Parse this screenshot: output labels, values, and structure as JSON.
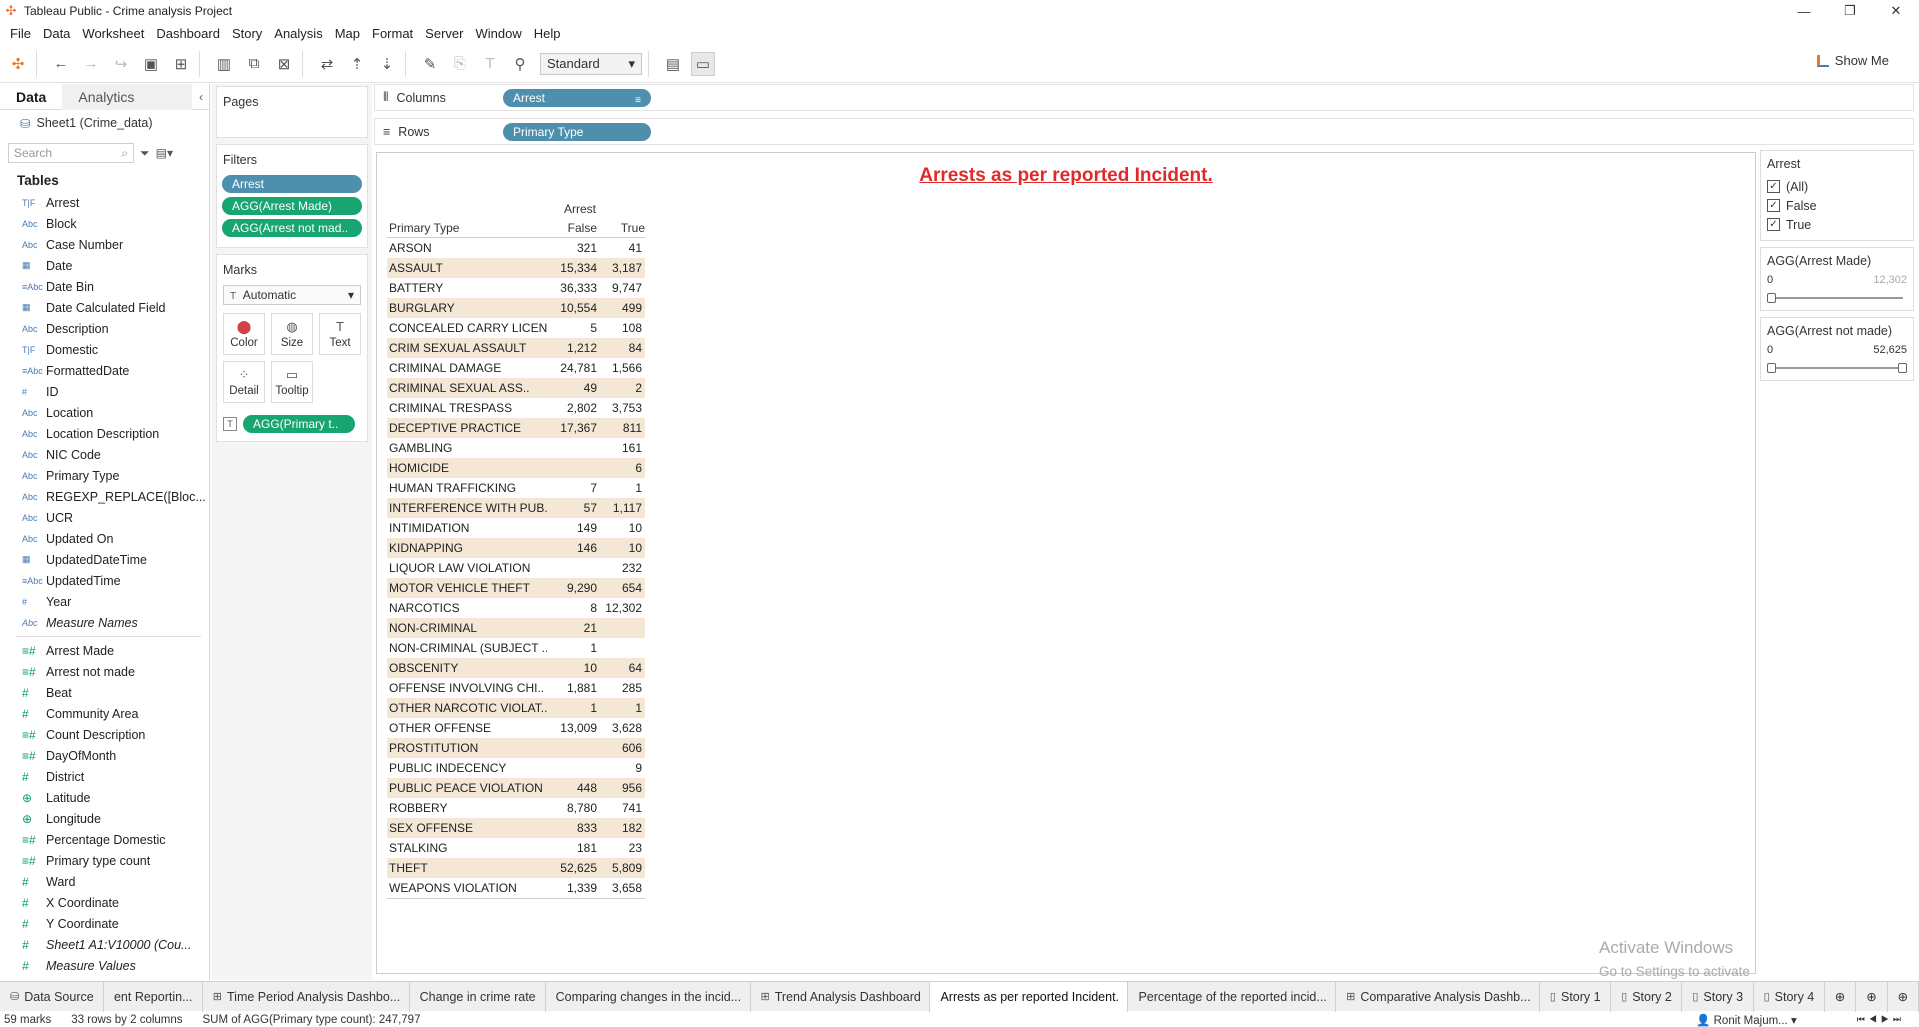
{
  "window": {
    "title": "Tableau Public - Crime analysis Project"
  },
  "menu": [
    "File",
    "Data",
    "Worksheet",
    "Dashboard",
    "Story",
    "Analysis",
    "Map",
    "Format",
    "Server",
    "Window",
    "Help"
  ],
  "toolbar": {
    "fit": "Standard",
    "show_me": "Show Me"
  },
  "datapane": {
    "tab_data": "Data",
    "tab_analytics": "Analytics",
    "datasource": "Sheet1 (Crime_data)",
    "search_placeholder": "Search",
    "tables_heading": "Tables",
    "dimensions": [
      {
        "type": "T|F",
        "name": "Arrest"
      },
      {
        "type": "Abc",
        "name": "Block"
      },
      {
        "type": "Abc",
        "name": "Case Number"
      },
      {
        "type": "▦",
        "name": "Date"
      },
      {
        "type": "≡Abc",
        "name": "Date Bin"
      },
      {
        "type": "▦",
        "name": "Date Calculated Field"
      },
      {
        "type": "Abc",
        "name": "Description"
      },
      {
        "type": "T|F",
        "name": "Domestic"
      },
      {
        "type": "≡Abc",
        "name": "FormattedDate"
      },
      {
        "type": "#",
        "name": "ID"
      },
      {
        "type": "Abc",
        "name": "Location"
      },
      {
        "type": "Abc",
        "name": "Location Description"
      },
      {
        "type": "Abc",
        "name": "NIC Code"
      },
      {
        "type": "Abc",
        "name": "Primary Type"
      },
      {
        "type": "Abc",
        "name": "REGEXP_REPLACE([Bloc..."
      },
      {
        "type": "Abc",
        "name": "UCR"
      },
      {
        "type": "Abc",
        "name": "Updated On"
      },
      {
        "type": "▦",
        "name": "UpdatedDateTime"
      },
      {
        "type": "≡Abc",
        "name": "UpdatedTime"
      },
      {
        "type": "#",
        "name": "Year"
      },
      {
        "type": "Abc",
        "name": "Measure Names",
        "italic": true
      }
    ],
    "measures": [
      {
        "type": "≡#",
        "name": "Arrest Made"
      },
      {
        "type": "≡#",
        "name": "Arrest not made"
      },
      {
        "type": "#",
        "name": "Beat"
      },
      {
        "type": "#",
        "name": "Community Area"
      },
      {
        "type": "≡#",
        "name": "Count Description"
      },
      {
        "type": "≡#",
        "name": "DayOfMonth"
      },
      {
        "type": "#",
        "name": "District"
      },
      {
        "type": "⊕",
        "name": "Latitude"
      },
      {
        "type": "⊕",
        "name": "Longitude"
      },
      {
        "type": "≡#",
        "name": "Percentage Domestic"
      },
      {
        "type": "≡#",
        "name": "Primary type count"
      },
      {
        "type": "#",
        "name": "Ward"
      },
      {
        "type": "#",
        "name": "X Coordinate"
      },
      {
        "type": "#",
        "name": "Y Coordinate"
      },
      {
        "type": "#",
        "name": "Sheet1 A1:V10000 (Cou...",
        "italic": true
      },
      {
        "type": "#",
        "name": "Measure Values",
        "italic": true
      }
    ]
  },
  "shelves": {
    "pages_label": "Pages",
    "filters_label": "Filters",
    "filters": [
      {
        "label": "Arrest",
        "color": "blue"
      },
      {
        "label": "AGG(Arrest Made)",
        "color": "green"
      },
      {
        "label": "AGG(Arrest not mad..",
        "color": "green"
      }
    ],
    "marks_label": "Marks",
    "mark_type": "Automatic",
    "mark_buttons": [
      {
        "label": "Color",
        "icon": "color-icon"
      },
      {
        "label": "Size",
        "icon": "size-icon"
      },
      {
        "label": "Text",
        "icon": "text-icon"
      },
      {
        "label": "Detail",
        "icon": "detail-icon"
      },
      {
        "label": "Tooltip",
        "icon": "tooltip-icon"
      }
    ],
    "mark_pill": "AGG(Primary t..",
    "columns_label": "Columns",
    "columns_pill": "Arrest",
    "rows_label": "Rows",
    "rows_pill": "Primary Type"
  },
  "view": {
    "title": "Arrests as per reported Incident.",
    "col_header": "Arrest",
    "row_header": "Primary Type",
    "col_values": [
      "False",
      "True"
    ],
    "rows": [
      [
        "ARSON",
        "321",
        "41"
      ],
      [
        "ASSAULT",
        "15,334",
        "3,187"
      ],
      [
        "BATTERY",
        "36,333",
        "9,747"
      ],
      [
        "BURGLARY",
        "10,554",
        "499"
      ],
      [
        "CONCEALED CARRY LICEN..",
        "5",
        "108"
      ],
      [
        "CRIM SEXUAL ASSAULT",
        "1,212",
        "84"
      ],
      [
        "CRIMINAL DAMAGE",
        "24,781",
        "1,566"
      ],
      [
        "CRIMINAL SEXUAL ASS..",
        "49",
        "2"
      ],
      [
        "CRIMINAL TRESPASS",
        "2,802",
        "3,753"
      ],
      [
        "DECEPTIVE PRACTICE",
        "17,367",
        "811"
      ],
      [
        "GAMBLING",
        "",
        "161"
      ],
      [
        "HOMICIDE",
        "",
        "6"
      ],
      [
        "HUMAN TRAFFICKING",
        "7",
        "1"
      ],
      [
        "INTERFERENCE WITH PUB..",
        "57",
        "1,117"
      ],
      [
        "INTIMIDATION",
        "149",
        "10"
      ],
      [
        "KIDNAPPING",
        "146",
        "10"
      ],
      [
        "LIQUOR LAW VIOLATION",
        "",
        "232"
      ],
      [
        "MOTOR VEHICLE THEFT",
        "9,290",
        "654"
      ],
      [
        "NARCOTICS",
        "8",
        "12,302"
      ],
      [
        "NON-CRIMINAL",
        "21",
        ""
      ],
      [
        "NON-CRIMINAL (SUBJECT ..",
        "1",
        ""
      ],
      [
        "OBSCENITY",
        "10",
        "64"
      ],
      [
        "OFFENSE INVOLVING CHI..",
        "1,881",
        "285"
      ],
      [
        "OTHER NARCOTIC VIOLAT..",
        "1",
        "1"
      ],
      [
        "OTHER OFFENSE",
        "13,009",
        "3,628"
      ],
      [
        "PROSTITUTION",
        "",
        "606"
      ],
      [
        "PUBLIC INDECENCY",
        "",
        "9"
      ],
      [
        "PUBLIC PEACE VIOLATION",
        "448",
        "956"
      ],
      [
        "ROBBERY",
        "8,780",
        "741"
      ],
      [
        "SEX OFFENSE",
        "833",
        "182"
      ],
      [
        "STALKING",
        "181",
        "23"
      ],
      [
        "THEFT",
        "52,625",
        "5,809"
      ],
      [
        "WEAPONS VIOLATION",
        "1,339",
        "3,658"
      ]
    ],
    "watermark_1": "Activate Windows",
    "watermark_2": "Go to Settings to activate Windows."
  },
  "filter_cards": {
    "arrest_title": "Arrest",
    "arrest_options": [
      "(All)",
      "False",
      "True"
    ],
    "made_title": "AGG(Arrest Made)",
    "made_min": "0",
    "made_max": "12,302",
    "not_made_title": "AGG(Arrest not made)",
    "not_made_min": "0",
    "not_made_max": "52,625"
  },
  "sheet_tabs": [
    {
      "label": "Data Source",
      "icon": "datasource-icon",
      "active": false
    },
    {
      "label": "ent Reportin...",
      "icon": "",
      "active": false
    },
    {
      "label": "Time Period Analysis Dashbo...",
      "icon": "dashboard-icon",
      "active": false
    },
    {
      "label": "Change in crime rate",
      "icon": "",
      "active": false
    },
    {
      "label": "Comparing changes in the incid...",
      "icon": "",
      "active": false
    },
    {
      "label": "Trend Analysis Dashboard",
      "icon": "dashboard-icon",
      "active": false
    },
    {
      "label": "Arrests as per reported Incident.",
      "icon": "",
      "active": true
    },
    {
      "label": "Percentage of the reported incid...",
      "icon": "",
      "active": false
    },
    {
      "label": "Comparative Analysis Dashb...",
      "icon": "dashboard-icon",
      "active": false
    },
    {
      "label": "Story 1",
      "icon": "story-icon",
      "active": false
    },
    {
      "label": "Story 2",
      "icon": "story-icon",
      "active": false
    },
    {
      "label": "Story 3",
      "icon": "story-icon",
      "active": false
    },
    {
      "label": "Story 4",
      "icon": "story-icon",
      "active": false
    }
  ],
  "status": {
    "marks": "59 marks",
    "dims": "33 rows by 2 columns",
    "sum": "SUM of AGG(Primary type count): 247,797",
    "user": "Ronit Majum..."
  }
}
